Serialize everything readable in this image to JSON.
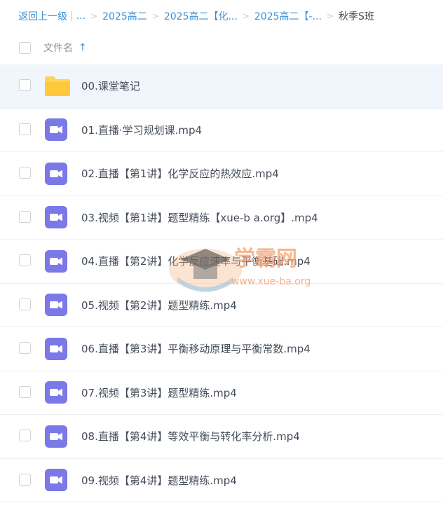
{
  "breadcrumb": {
    "back": "返回上一级",
    "ellipsis": "...",
    "items": [
      "2025高二",
      "2025高二【化...",
      "2025高二【-..."
    ],
    "current": "秋季S班"
  },
  "header": {
    "column_label": "文件名",
    "sort_icon": "arrow-up-icon"
  },
  "files": [
    {
      "name": "00.课堂笔记",
      "type": "folder",
      "selected": true
    },
    {
      "name": "01.直播·学习规划课.mp4",
      "type": "video"
    },
    {
      "name": "02.直播【第1讲】化学反应的热效应.mp4",
      "type": "video"
    },
    {
      "name": "03.视频【第1讲】题型精练【xue-b a.org】.mp4",
      "type": "video"
    },
    {
      "name": "04.直播【第2讲】化学反应速率与平衡基础.mp4",
      "type": "video"
    },
    {
      "name": "05.视频【第2讲】题型精练.mp4",
      "type": "video"
    },
    {
      "name": "06.直播【第3讲】平衡移动原理与平衡常数.mp4",
      "type": "video"
    },
    {
      "name": "07.视频【第3讲】题型精练.mp4",
      "type": "video"
    },
    {
      "name": "08.直播【第4讲】等效平衡与转化率分析.mp4",
      "type": "video"
    },
    {
      "name": "09.视频【第4讲】题型精练.mp4",
      "type": "video"
    }
  ],
  "watermark": {
    "text": "学霸网",
    "url": "www.xue-ba.org"
  },
  "colors": {
    "link": "#3b8fd6",
    "video_icon": "#7b78e8",
    "folder": "#ffd25a",
    "selected_row": "#f1f6fc"
  }
}
